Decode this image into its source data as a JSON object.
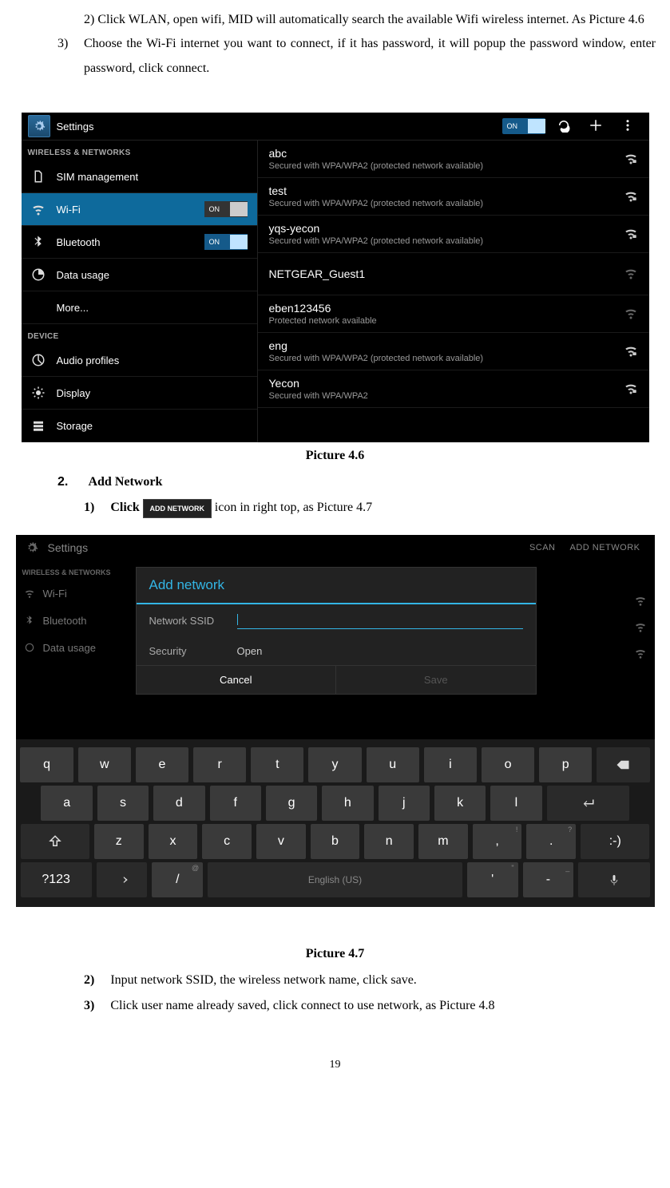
{
  "step2": "2)  Click WLAN, open wifi, MID will automatically search the available Wifi wireless internet. As Picture 4.6",
  "step3_num": "3)",
  "step3": "Choose the Wi-Fi internet you want to connect, if it has password, it will popup the password window, enter password, click connect.",
  "caption1": "Picture 4.6",
  "subhead_num": "2.",
  "subhead": "Add Network",
  "sub1_num": "1)",
  "sub1_a": "Click ",
  "sub1_icon": "ADD NETWORK",
  "sub1_b": " icon in right top, as Picture 4.7",
  "caption2": "Picture 4.7",
  "sub2_num": "2)",
  "sub2": "Input network SSID, the wireless network name, click save.",
  "sub3_num": "3)",
  "sub3": "Click user name already saved, click connect to use network, as Picture 4.8",
  "page": "19",
  "shot1": {
    "title": "Settings",
    "on": "ON",
    "sect1": "WIRELESS & NETWORKS",
    "sect2": "DEVICE",
    "rows": {
      "sim": "SIM management",
      "wifi": "Wi-Fi",
      "bt": "Bluetooth",
      "data": "Data usage",
      "more": "More...",
      "audio": "Audio profiles",
      "display": "Display",
      "storage": "Storage"
    },
    "nets": [
      {
        "name": "abc",
        "sub": "Secured with WPA/WPA2 (protected network available)"
      },
      {
        "name": "test",
        "sub": "Secured with WPA/WPA2 (protected network available)"
      },
      {
        "name": "yqs-yecon",
        "sub": "Secured with WPA/WPA2 (protected network available)"
      },
      {
        "name": "NETGEAR_Guest1",
        "sub": ""
      },
      {
        "name": "eben123456",
        "sub": "Protected network available"
      },
      {
        "name": "eng",
        "sub": "Secured with WPA/WPA2 (protected network available)"
      },
      {
        "name": "Yecon",
        "sub": "Secured with WPA/WPA2"
      }
    ]
  },
  "shot2": {
    "title": "Settings",
    "scan": "SCAN",
    "addnet": "ADD NETWORK",
    "sect": "WIRELESS & NETWORKS",
    "wifi": "Wi-Fi",
    "bt": "Bluetooth",
    "data": "Data usage",
    "dlg_title": "Add network",
    "ssid_lbl": "Network SSID",
    "sec_lbl": "Security",
    "sec_val": "Open",
    "cancel": "Cancel",
    "save": "Save",
    "kbd": {
      "r1": [
        "q",
        "w",
        "e",
        "r",
        "t",
        "y",
        "u",
        "i",
        "o",
        "p"
      ],
      "r2": [
        "a",
        "s",
        "d",
        "f",
        "g",
        "h",
        "j",
        "k",
        "l"
      ],
      "r3": [
        "z",
        "x",
        "c",
        "v",
        "b",
        "n",
        "m",
        ",",
        "."
      ],
      "sym": "?123",
      "slash": "/",
      "space": "English (US)",
      "apos": "'",
      "dash": "-",
      "smile": ":-)"
    }
  }
}
